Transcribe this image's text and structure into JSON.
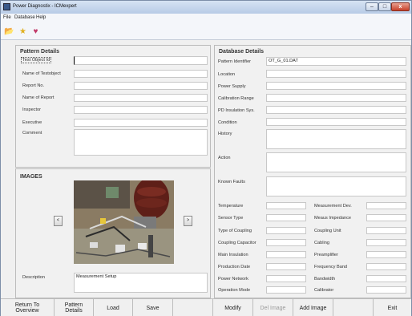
{
  "window": {
    "title": "Power Diagnostix - ICMexpert",
    "min": "–",
    "max": "□",
    "close": "x"
  },
  "menu": [
    "File",
    "Database",
    "Help"
  ],
  "toolbar": {
    "open": "📂",
    "star": "★",
    "heart": "♥"
  },
  "pattern": {
    "heading": "Pattern Details",
    "fields": [
      {
        "label": "Test Object Id",
        "value": ""
      },
      {
        "label": "Name of Testobject",
        "value": ""
      },
      {
        "label": "Report No.",
        "value": ""
      },
      {
        "label": "Name of Report",
        "value": ""
      },
      {
        "label": "Inspector",
        "value": ""
      },
      {
        "label": "Executive",
        "value": ""
      },
      {
        "label": "Comment",
        "value": ""
      }
    ]
  },
  "images": {
    "heading": "IMAGES",
    "prev": "<",
    "next": ">",
    "description_label": "Description",
    "description_value": "Measurement Setup"
  },
  "database": {
    "heading": "Database Details",
    "fields": [
      {
        "label": "Pattern Identifier",
        "value": "OT_G_01.DAT"
      },
      {
        "label": "Location",
        "value": ""
      },
      {
        "label": "Power Supply",
        "value": ""
      },
      {
        "label": "Calibration Range",
        "value": ""
      },
      {
        "label": "PD Insulation Sys.",
        "value": ""
      },
      {
        "label": "Condition",
        "value": ""
      },
      {
        "label": "History",
        "value": ""
      },
      {
        "label": "Action",
        "value": ""
      },
      {
        "label": "Known Faults",
        "value": ""
      }
    ],
    "grid_left": [
      "Temperature",
      "Sensor Type",
      "Type of Coupling",
      "Coupling Capacitor",
      "Main Insulation",
      "Production Date",
      "Power Network",
      "Operation Mode"
    ],
    "grid_right": [
      "Measurement Dev.",
      "Meaus Impedance",
      "Coupling Unit",
      "Cabling",
      "Preamplifier",
      "Frequency Band",
      "Bandwidth",
      "Calibrator"
    ]
  },
  "bottom": {
    "return": [
      "Return To",
      "Overview"
    ],
    "pattern": [
      "Pattern",
      "Details"
    ],
    "load": "Load",
    "save": "Save",
    "modify": "Modify",
    "del_image": "Del Image",
    "add_image": "Add Image",
    "exit": "Exit"
  }
}
